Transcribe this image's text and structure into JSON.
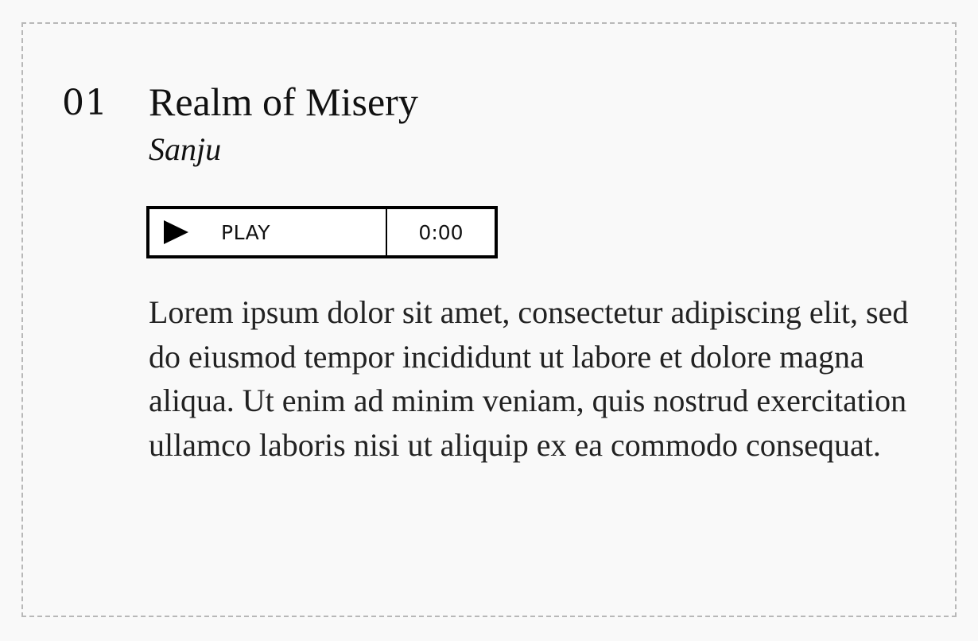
{
  "track": {
    "number": "01",
    "title": "Realm of Misery",
    "artist": "Sanju",
    "description": "Lorem ipsum dolor sit amet, consectetur adipiscing elit, sed do eiusmod tempor incididunt ut labore et dolore magna aliqua. Ut enim ad minim veniam, quis nostrud exercitation ullamco laboris nisi ut aliquip ex ea commodo consequat."
  },
  "player": {
    "play_label": "PLAY",
    "play_icon": "play-icon",
    "time": "0:00"
  },
  "colors": {
    "background": "#f9f9f9",
    "text": "#111111",
    "border": "#000000",
    "frame_dash": "#b8b8b8"
  }
}
